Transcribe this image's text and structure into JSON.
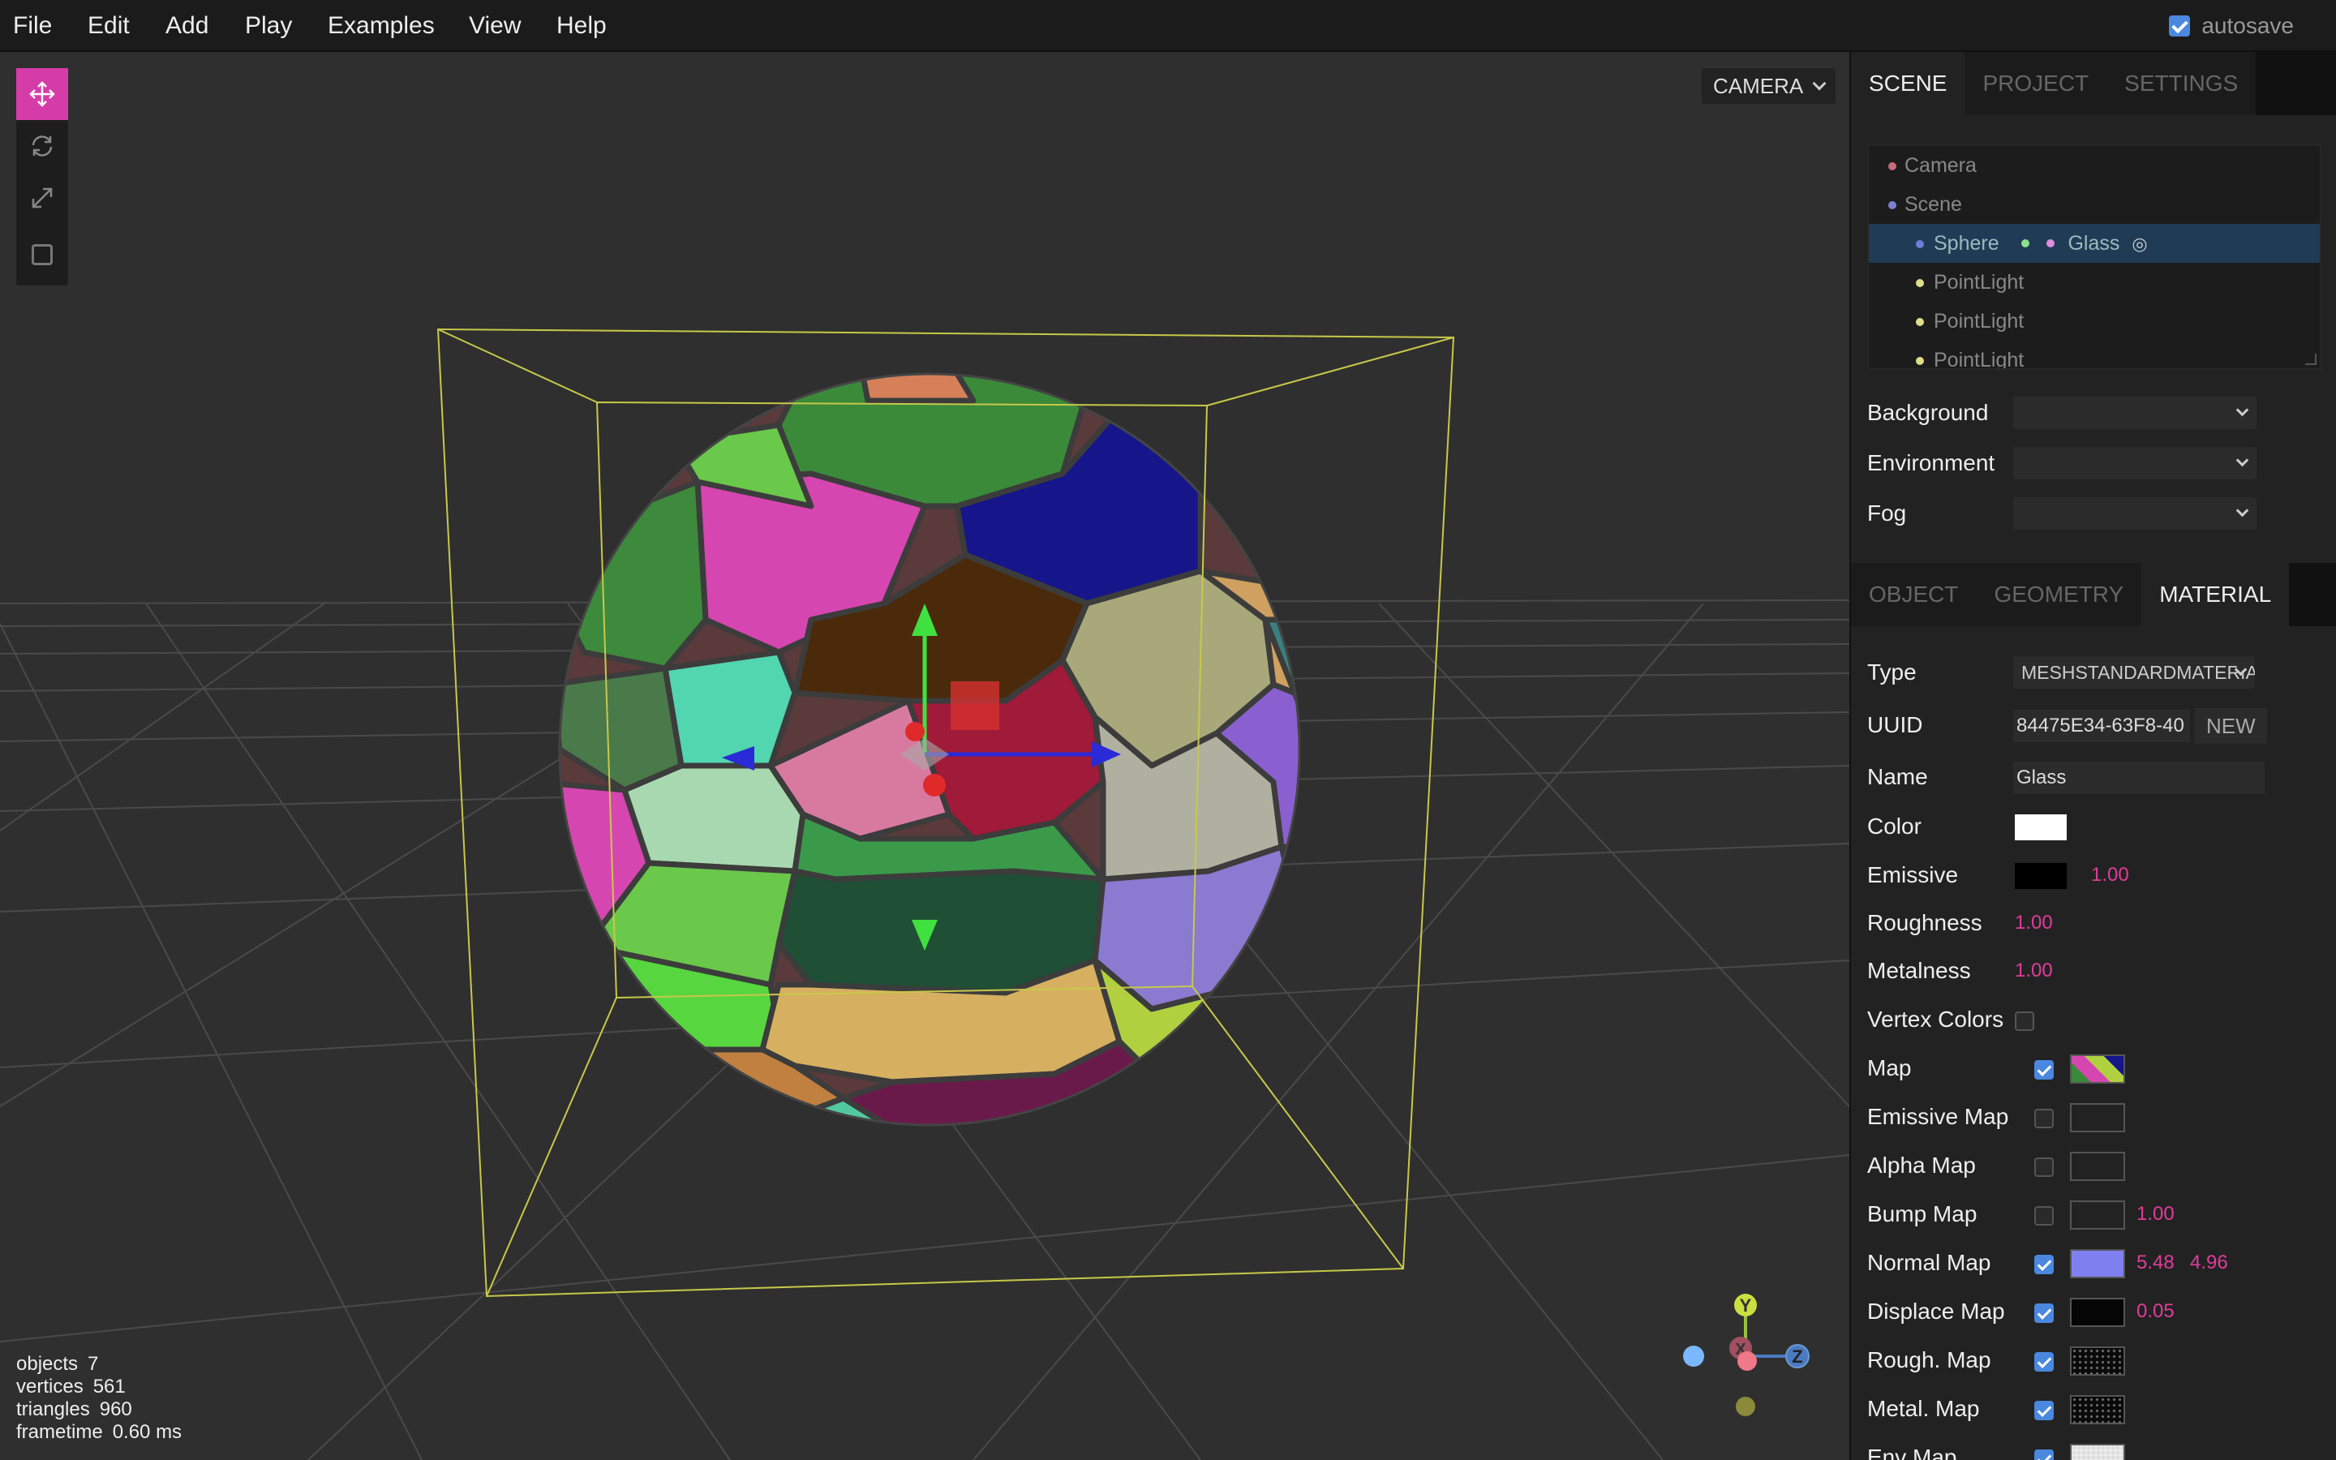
{
  "menubar": {
    "items": [
      "File",
      "Edit",
      "Add",
      "Play",
      "Examples",
      "View",
      "Help"
    ],
    "autosave_label": "autosave",
    "autosave_checked": true
  },
  "viewport": {
    "camera_select": "CAMERA",
    "info": {
      "objects_label": "objects",
      "objects_value": "7",
      "vertices_label": "vertices",
      "vertices_value": "561",
      "triangles_label": "triangles",
      "triangles_value": "960",
      "frametime_label": "frametime",
      "frametime_value": "0.60 ms"
    },
    "axes": {
      "y": "Y",
      "z": "Z",
      "x": "X"
    },
    "toolbar": [
      "translate-icon",
      "rotate-icon",
      "scale-icon",
      "local-toggle"
    ]
  },
  "sidebar": {
    "top_tabs": [
      "SCENE",
      "PROJECT",
      "SETTINGS"
    ],
    "top_tab_selected": "SCENE",
    "outliner": [
      {
        "label": "Camera",
        "dot": "#c56b7a",
        "child": false
      },
      {
        "label": "Scene",
        "dot": "#7f7fd0",
        "child": false
      },
      {
        "label": "Sphere",
        "dot": "#6b7fd8",
        "child": true,
        "selected": true,
        "geometry_dot": "#8ce08c",
        "material_dot": "#e08ce0",
        "material": "Glass"
      },
      {
        "label": "PointLight",
        "dot": "#dede8a",
        "child": true
      },
      {
        "label": "PointLight",
        "dot": "#dede8a",
        "child": true
      },
      {
        "label": "PointLight",
        "dot": "#dede8a",
        "child": true
      }
    ],
    "scene_props": {
      "background_label": "Background",
      "background_value": "",
      "environment_label": "Environment",
      "environment_value": "",
      "fog_label": "Fog",
      "fog_value": ""
    },
    "prop_tabs": [
      "OBJECT",
      "GEOMETRY",
      "MATERIAL"
    ],
    "prop_tab_selected": "MATERIAL",
    "material": {
      "type_label": "Type",
      "type_value": "MESHSTANDARDMATERIAL",
      "uuid_label": "UUID",
      "uuid_value": "84475E34-63F8-40",
      "uuid_new": "NEW",
      "name_label": "Name",
      "name_value": "Glass",
      "color_label": "Color",
      "color_value": "#ffffff",
      "emissive_label": "Emissive",
      "emissive_color": "#000000",
      "emissive_intensity": "1.00",
      "roughness_label": "Roughness",
      "roughness_value": "1.00",
      "metalness_label": "Metalness",
      "metalness_value": "1.00",
      "vertex_colors_label": "Vertex Colors",
      "vertex_colors": false,
      "map_label": "Map",
      "map": true,
      "emissive_map_label": "Emissive Map",
      "emissive_map": false,
      "alpha_map_label": "Alpha Map",
      "alpha_map": false,
      "bump_map_label": "Bump Map",
      "bump_map": false,
      "bump_scale": "1.00",
      "normal_map_label": "Normal Map",
      "normal_map": true,
      "normal_scale_x": "5.48",
      "normal_scale_y": "4.96",
      "displace_map_label": "Displace Map",
      "displace_map": true,
      "displace_scale": "0.05",
      "rough_map_label": "Rough. Map",
      "rough_map": true,
      "metal_map_label": "Metal. Map",
      "metal_map": true,
      "env_map_label": "Env Map",
      "env_map": true
    }
  },
  "colors": {
    "accent": "#d63ca8",
    "value": "#e03c9a",
    "selection": "#1f3b56",
    "checkbox": "#4a88e0"
  }
}
